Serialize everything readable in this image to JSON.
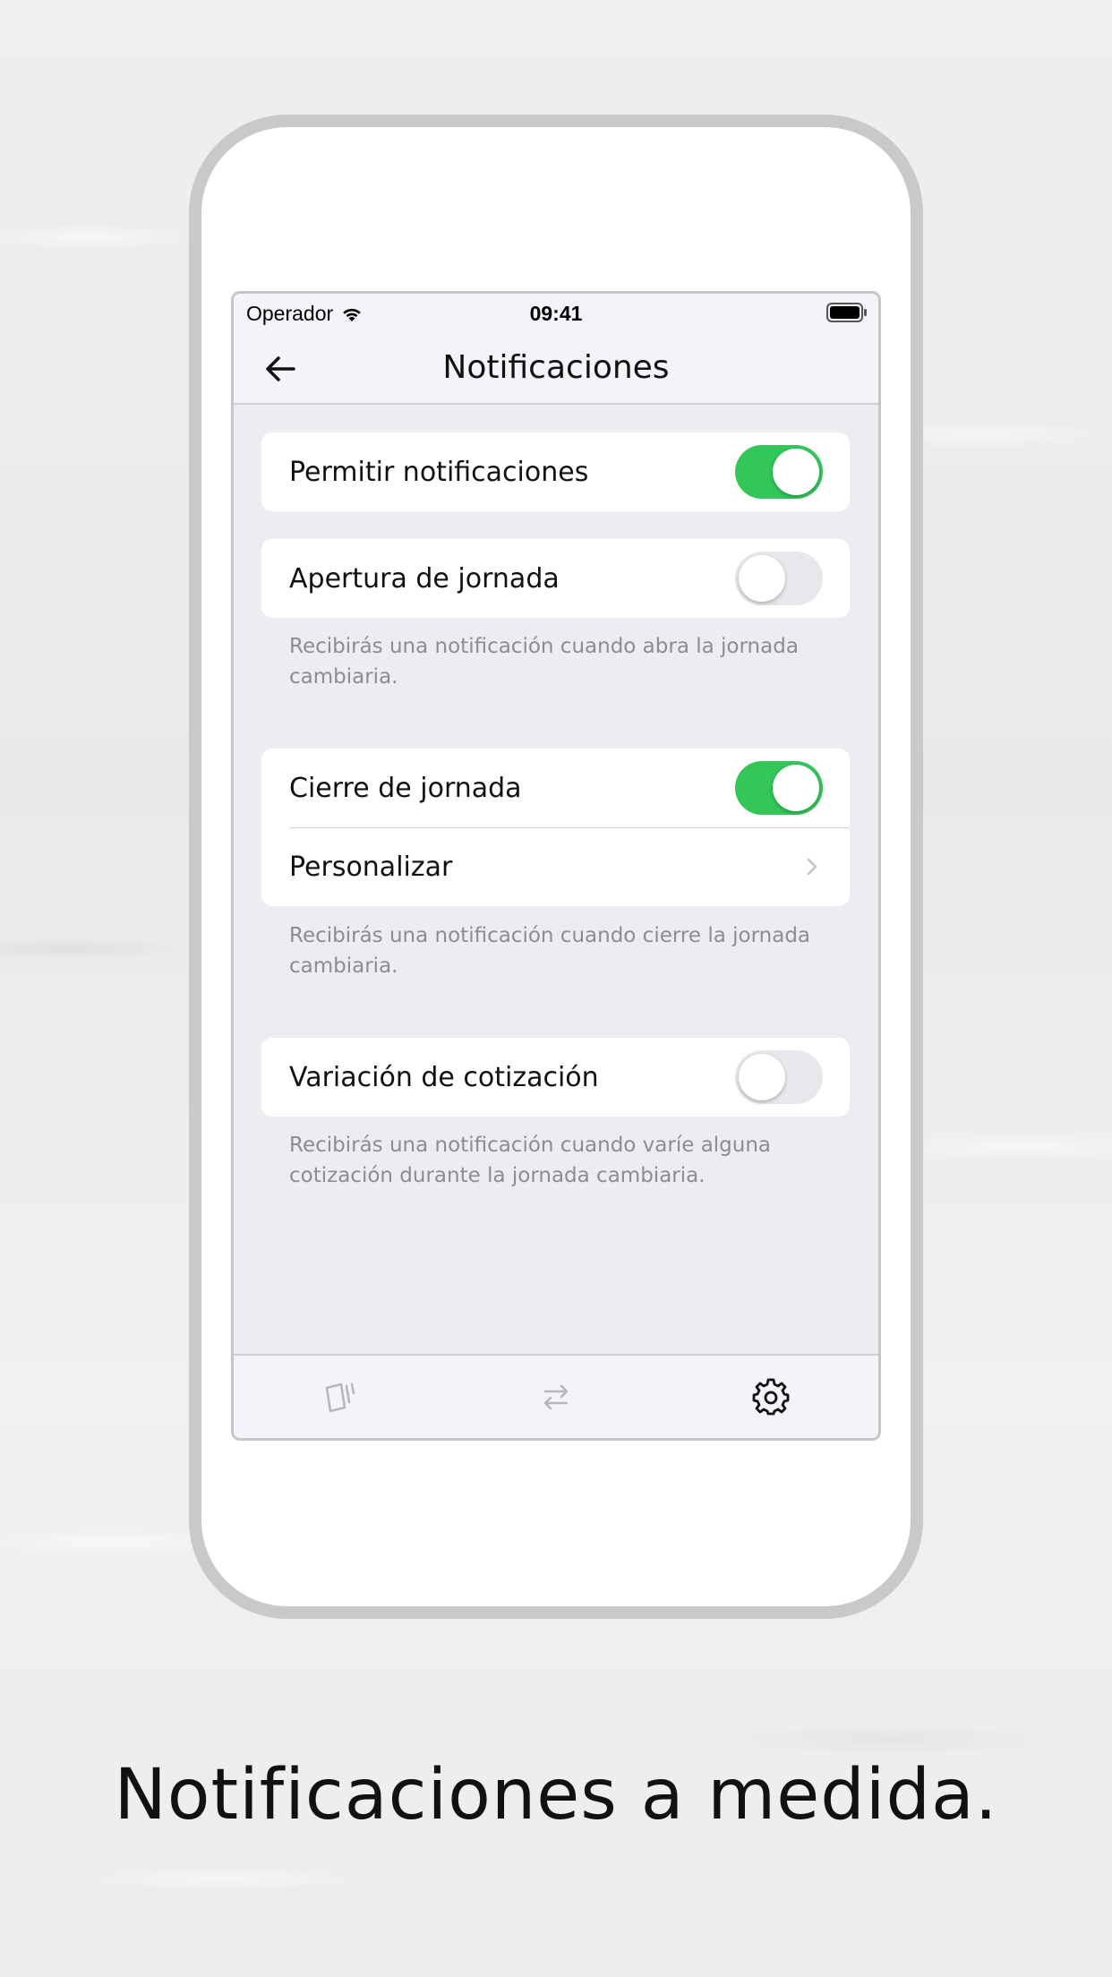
{
  "status_bar": {
    "carrier": "Operador",
    "time": "09:41",
    "wifi_icon": "wifi-icon",
    "battery_icon": "battery-icon"
  },
  "nav": {
    "title": "Notificaciones",
    "back_icon": "arrow-left-icon"
  },
  "sections": [
    {
      "rows": [
        {
          "label": "Permitir notificaciones",
          "control": "toggle",
          "on": true
        }
      ],
      "footnote": ""
    },
    {
      "rows": [
        {
          "label": "Apertura de jornada",
          "control": "toggle",
          "on": false
        }
      ],
      "footnote": "Recibirás una notificación cuando abra la jornada cambiaria."
    },
    {
      "rows": [
        {
          "label": "Cierre de jornada",
          "control": "toggle",
          "on": true
        },
        {
          "label": "Personalizar",
          "control": "disclosure"
        }
      ],
      "footnote": "Recibirás una notificación cuando cierre la jornada cambiaria."
    },
    {
      "rows": [
        {
          "label": "Variación de cotización",
          "control": "toggle",
          "on": false
        }
      ],
      "footnote": "Recibirás una notificación cuando varíe alguna cotización durante la jornada cambiaria."
    }
  ],
  "tab_bar": {
    "tabs": [
      {
        "icon": "cards-icon",
        "active": false
      },
      {
        "icon": "exchange-arrows-icon",
        "active": false
      },
      {
        "icon": "gear-icon",
        "active": true
      }
    ]
  },
  "colors": {
    "toggle_on": "#34c659",
    "toggle_off": "#e8e8ec",
    "background": "#ececf1",
    "footnote": "#8c8c93"
  },
  "caption": "Notificaciones a medida."
}
